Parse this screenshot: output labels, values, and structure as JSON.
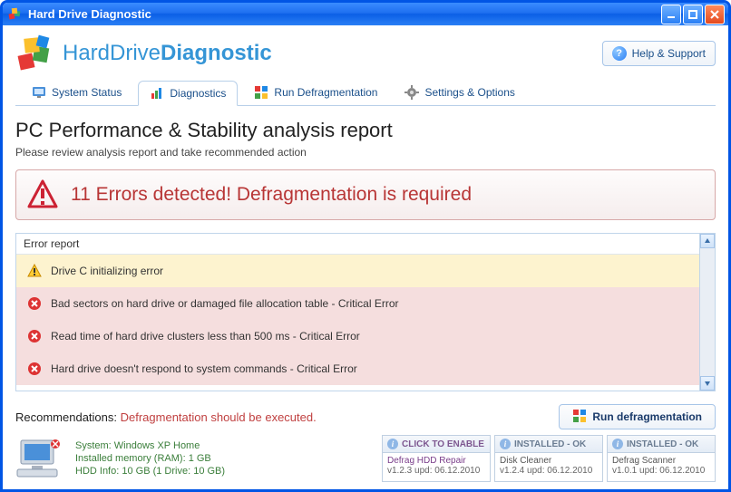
{
  "window": {
    "title": "Hard Drive Diagnostic"
  },
  "header": {
    "brand_part1": "HardDrive",
    "brand_part2": "Diagnostic",
    "help_label": "Help & Support"
  },
  "tabs": [
    {
      "label": "System Status"
    },
    {
      "label": "Diagnostics"
    },
    {
      "label": "Run Defragmentation"
    },
    {
      "label": "Settings & Options"
    }
  ],
  "report": {
    "heading": "PC Performance & Stability analysis report",
    "subtitle": "Please review analysis report and take recommended action"
  },
  "alert": {
    "message": "11 Errors detected! Defragmentation is required"
  },
  "error_panel": {
    "caption": "Error report",
    "rows": [
      {
        "type": "warn",
        "text": "Drive C initializing error"
      },
      {
        "type": "crit",
        "text": "Bad sectors on hard drive or damaged file allocation table - Critical Error"
      },
      {
        "type": "crit",
        "text": "Read time of hard drive clusters less than 500 ms - Critical Error"
      },
      {
        "type": "crit",
        "text": "Hard drive doesn't respond to system commands - Critical Error"
      }
    ]
  },
  "recommendation": {
    "label": "Recommendations: ",
    "value": "Defragmentation should be executed.",
    "button": "Run defragmentation"
  },
  "sysinfo": {
    "line1": "System: Windows XP Home",
    "line2": "Installed memory (RAM): 1 GB",
    "line3": "HDD Info: 10 GB (1 Drive: 10 GB)"
  },
  "modules": [
    {
      "status": "CLICK TO ENABLE",
      "name": "Defrag HDD Repair",
      "ver": "v1.2.3 upd: 06.12.2010",
      "enable": true
    },
    {
      "status": "INSTALLED - OK",
      "name": "Disk Cleaner",
      "ver": "v1.2.4 upd: 06.12.2010",
      "enable": false
    },
    {
      "status": "INSTALLED - OK",
      "name": "Defrag Scanner",
      "ver": "v1.0.1 upd: 06.12.2010",
      "enable": false
    }
  ]
}
